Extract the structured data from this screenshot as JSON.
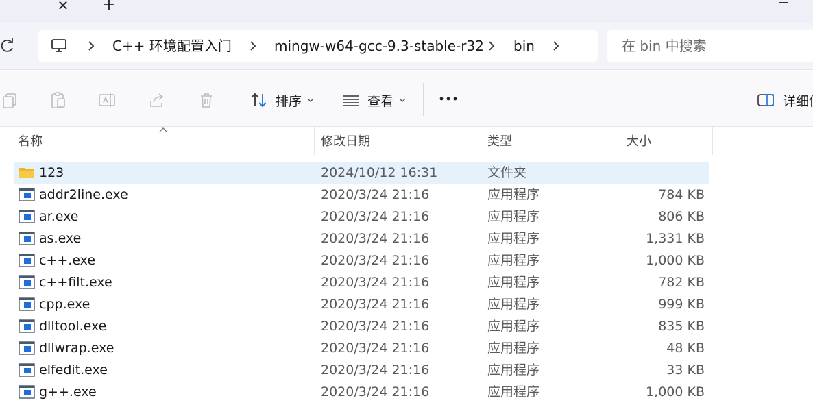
{
  "tabstrip": {
    "close_glyph": "✕",
    "new_tab_glyph": "+"
  },
  "addressbar": {
    "refresh_icon": "refresh-icon",
    "crumbs": [
      "C++ 环境配置入门",
      "mingw-w64-gcc-9.3-stable-r32",
      "bin"
    ],
    "search_placeholder": "在 bin 中搜索"
  },
  "commandbar": {
    "sort_label": "排序",
    "view_label": "查看",
    "details_label": "详细信"
  },
  "columns": {
    "name": "名称",
    "modified": "修改日期",
    "type": "类型",
    "size": "大小"
  },
  "files": [
    {
      "name": "123",
      "modified": "2024/10/12 16:31",
      "type": "文件夹",
      "size": "",
      "icon": "folder-icon",
      "selected": true
    },
    {
      "name": "addr2line.exe",
      "modified": "2020/3/24 21:16",
      "type": "应用程序",
      "size": "784 KB",
      "icon": "app-icon"
    },
    {
      "name": "ar.exe",
      "modified": "2020/3/24 21:16",
      "type": "应用程序",
      "size": "806 KB",
      "icon": "app-icon"
    },
    {
      "name": "as.exe",
      "modified": "2020/3/24 21:16",
      "type": "应用程序",
      "size": "1,331 KB",
      "icon": "app-icon"
    },
    {
      "name": "c++.exe",
      "modified": "2020/3/24 21:16",
      "type": "应用程序",
      "size": "1,000 KB",
      "icon": "app-icon"
    },
    {
      "name": "c++filt.exe",
      "modified": "2020/3/24 21:16",
      "type": "应用程序",
      "size": "782 KB",
      "icon": "app-icon"
    },
    {
      "name": "cpp.exe",
      "modified": "2020/3/24 21:16",
      "type": "应用程序",
      "size": "999 KB",
      "icon": "app-icon"
    },
    {
      "name": "dlltool.exe",
      "modified": "2020/3/24 21:16",
      "type": "应用程序",
      "size": "835 KB",
      "icon": "app-icon"
    },
    {
      "name": "dllwrap.exe",
      "modified": "2020/3/24 21:16",
      "type": "应用程序",
      "size": "48 KB",
      "icon": "app-icon"
    },
    {
      "name": "elfedit.exe",
      "modified": "2020/3/24 21:16",
      "type": "应用程序",
      "size": "33 KB",
      "icon": "app-icon"
    },
    {
      "name": "g++.exe",
      "modified": "2020/3/24 21:16",
      "type": "应用程序",
      "size": "1,000 KB",
      "icon": "app-icon"
    }
  ],
  "colors": {
    "selection": "#e5f1fb",
    "folder": "#f7c948",
    "app_accent": "#1e6fd9",
    "window_bg": "#eef0f7"
  }
}
